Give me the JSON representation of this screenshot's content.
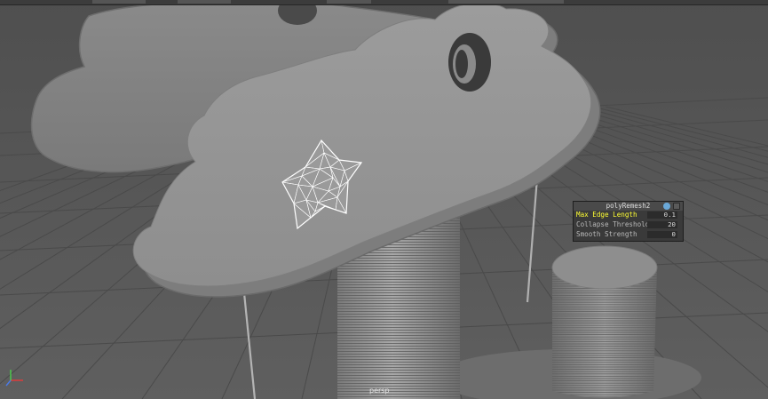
{
  "app": "3D modeling viewport",
  "viewport": {
    "camera_label": "persp",
    "background": "#5a5a5a",
    "grid_color": "#4a4a4a"
  },
  "hud": {
    "title": "polyRemesh2",
    "rows": [
      {
        "label": "Max Edge Length",
        "value": "0.1",
        "highlight": true
      },
      {
        "label": "Collapse Threshold",
        "value": "20",
        "highlight": false
      },
      {
        "label": "Smooth Strength",
        "value": "0",
        "highlight": false
      }
    ],
    "highlight_color": "#ffff33"
  },
  "selection": {
    "object": "star",
    "wire_color": "#ffffff"
  },
  "axis_indicator": {
    "x_color": "#e83a3a",
    "y_color": "#4ad24a",
    "z_color": "#4a7ae8"
  }
}
